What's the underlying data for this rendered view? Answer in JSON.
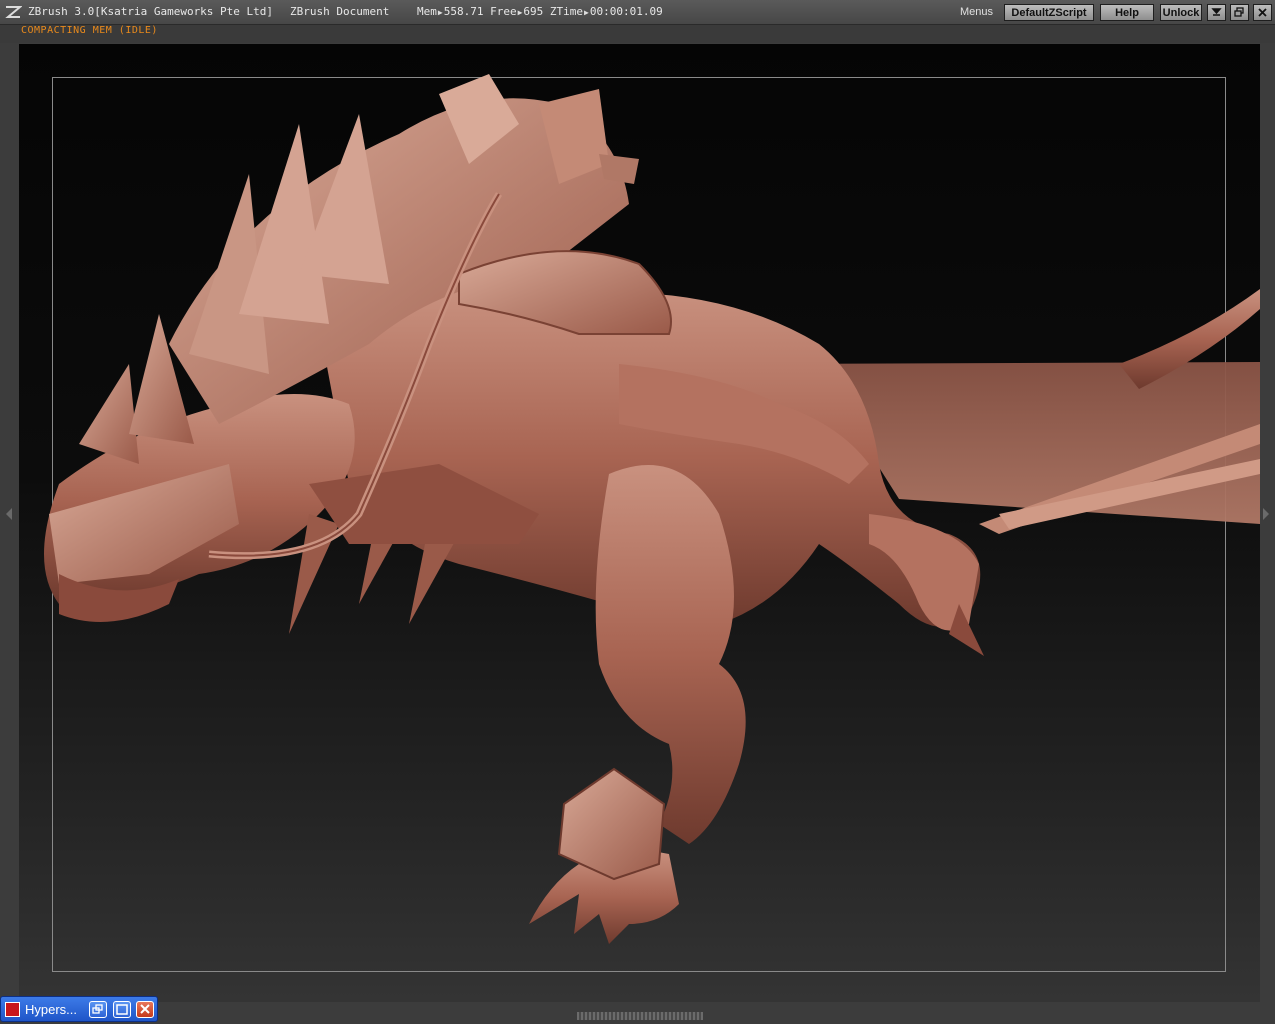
{
  "titlebar": {
    "app": "ZBrush  3.0[Ksatria Gameworks Pte Ltd]",
    "document": "ZBrush Document",
    "mem_label": "Mem",
    "mem_value": "558.71",
    "free_label": "Free",
    "free_value": "695",
    "ztime_label": "ZTime",
    "ztime_value": "00:00:01.09",
    "menus_label": "Menus",
    "script_button": "DefaultZScript",
    "help_button": "Help",
    "unlock_button": "Unlock"
  },
  "status": {
    "text": "COMPACTING MEM (IDLE)"
  },
  "canvas": {
    "model_color": "#a86452"
  },
  "taskbar": {
    "label": "Hypers..."
  },
  "colors": {
    "status_orange": "#e98a1c",
    "taskbar_blue": "#2c63d6"
  }
}
